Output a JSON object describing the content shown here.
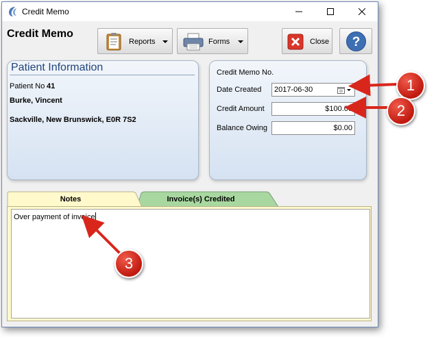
{
  "window": {
    "title": "Credit Memo"
  },
  "heading": "Credit Memo",
  "toolbar": {
    "reports_label": "Reports",
    "forms_label": "Forms",
    "close_label": "Close"
  },
  "patient": {
    "panel_title": "Patient Information",
    "no_label": "Patient No",
    "no_value": "41",
    "name": "Burke, Vincent",
    "address": "Sackville, New Brunswick, E0R 7S2"
  },
  "memo": {
    "no_label": "Credit Memo No.",
    "date_label": "Date Created",
    "date_value": "2017-06-30",
    "amount_label": "Credit Amount",
    "amount_value": "$100.00",
    "balance_label": "Balance Owing",
    "balance_value": "$0.00"
  },
  "tabs": {
    "notes": "Notes",
    "invoices": "Invoice(s) Credited"
  },
  "notes_text": "Over payment of invoice",
  "callouts": [
    "1",
    "2",
    "3"
  ],
  "colors": {
    "accent": "#20447a",
    "callout": "#d9261c",
    "notes_tab": "#fff9cc",
    "invoice_tab": "#a8d8a0"
  }
}
